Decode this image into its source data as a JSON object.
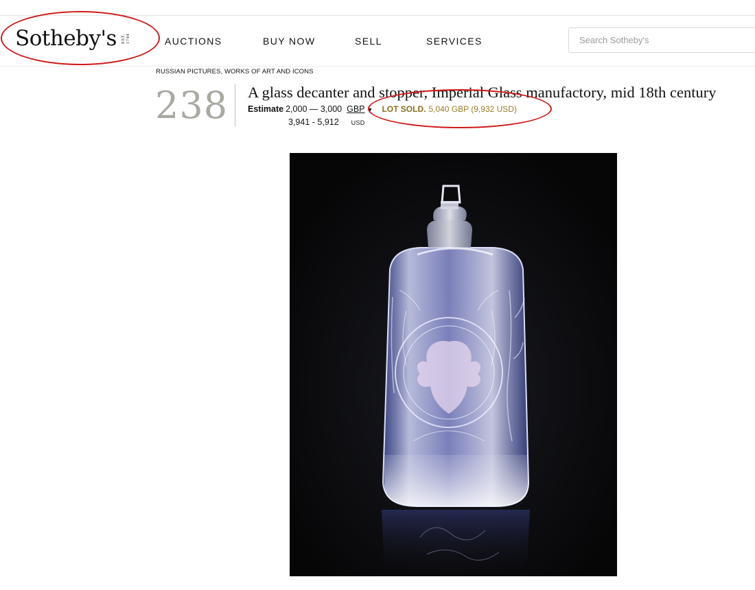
{
  "header": {
    "logo_text": "Sotheby's",
    "logo_est": [
      "EST.",
      "1744"
    ],
    "nav": [
      {
        "label": "AUCTIONS"
      },
      {
        "label": "BUY NOW"
      },
      {
        "label": "SELL"
      },
      {
        "label": "SERVICES"
      }
    ],
    "search": {
      "placeholder": "Search Sotheby's"
    }
  },
  "lot": {
    "category": "RUSSIAN PICTURES, WORKS OF ART AND ICONS",
    "number": "238",
    "title": "A glass decanter and stopper, Imperial Glass manufactory, mid 18th century",
    "estimate_label": "Estimate",
    "estimate_range": "2,000 — 3,000",
    "currency": "GBP",
    "sold_label": "LOT SOLD.",
    "sold_value": "5,040 GBP (9,932 USD)",
    "usd_range": "3,941 - 5,912",
    "usd_code": "USD"
  },
  "colors": {
    "annotation_red": "#d01818",
    "sold_gold": "#9a7b24",
    "lot_number_gray": "#a9a9a2"
  }
}
